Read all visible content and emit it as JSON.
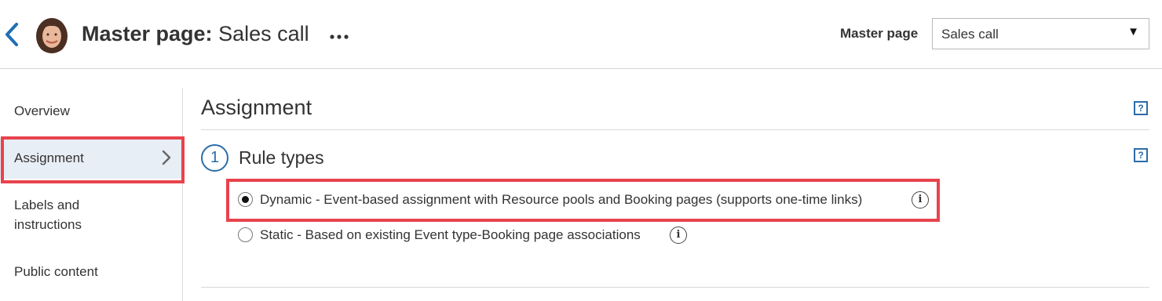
{
  "header": {
    "back_icon": "chevron-left-icon",
    "title_strong": "Master page:",
    "title_rest": " Sales call",
    "more_icon": "more-horizontal-icon",
    "master_page_label": "Master page",
    "master_page_selected": "Sales call",
    "caret": "▼"
  },
  "sidebar": {
    "items": [
      {
        "label": "Overview"
      },
      {
        "label": "Assignment",
        "active": true
      },
      {
        "label": "Labels and instructions"
      },
      {
        "label": "Public content"
      }
    ]
  },
  "main": {
    "section_title": "Assignment",
    "help_glyph": "?",
    "step_number": "1",
    "rule_types_title": "Rule types",
    "options": [
      {
        "label": "Dynamic - Event-based assignment with Resource pools and Booking pages (supports one-time links)",
        "selected": true
      },
      {
        "label": "Static - Based on existing Event type-Booking page associations",
        "selected": false
      }
    ],
    "info_glyph": "i"
  },
  "colors": {
    "accent": "#2b6ca8",
    "highlight": "#e8434d",
    "active_bg": "#e8eef5"
  }
}
